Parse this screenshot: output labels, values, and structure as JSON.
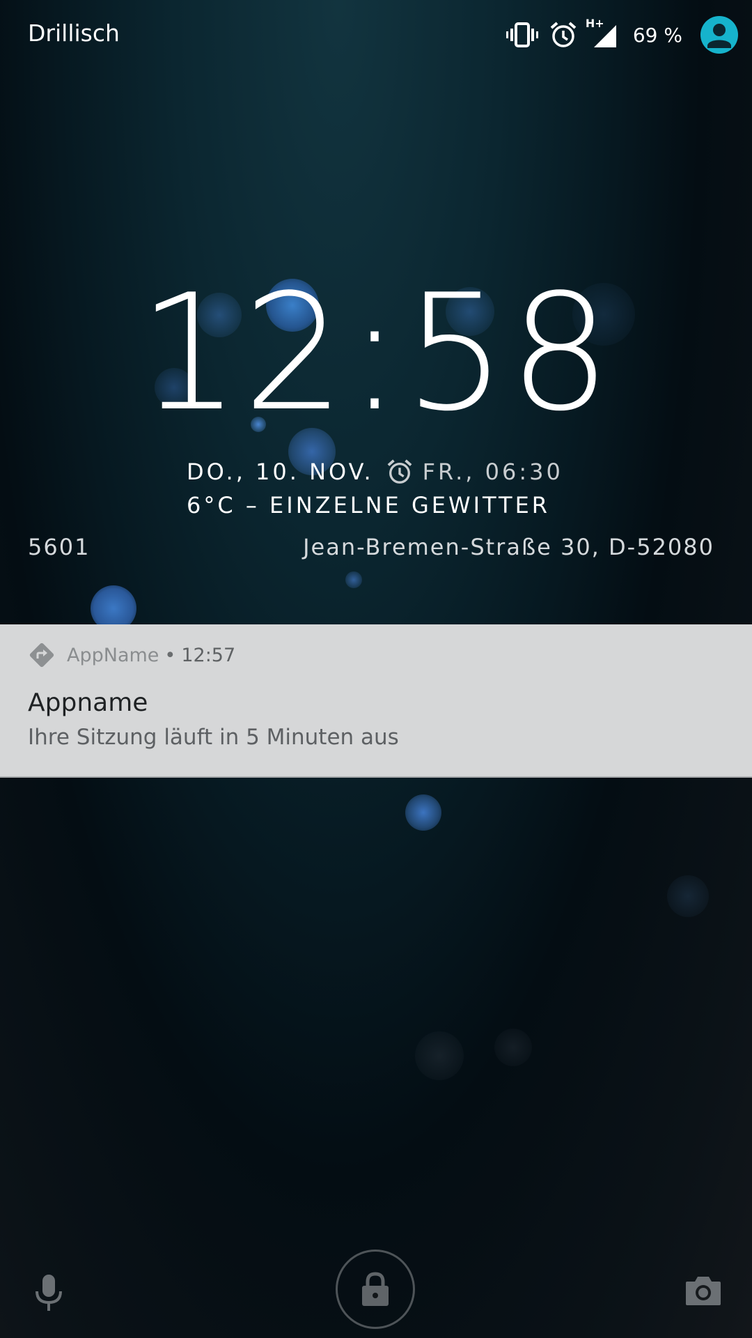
{
  "status_bar": {
    "carrier": "Drillisch",
    "network_type": "H+",
    "battery": "69 %",
    "icons": [
      "vibrate-icon",
      "alarm-icon",
      "signal-icon",
      "user-avatar-icon"
    ]
  },
  "lockscreen": {
    "time": "12:58",
    "date": "DO., 10. NOV.",
    "next_alarm": "FR., 06:30",
    "weather": "6°C – EINZELNE GEWITTER",
    "address_left": "5601",
    "address_right": "Jean-Bremen-Straße 30, D-52080"
  },
  "notification": {
    "app_name": "AppName",
    "separator": "•",
    "time": "12:57",
    "title": "Appname",
    "text": "Ihre Sitzung läuft in 5 Minuten aus",
    "icon": "directions-icon"
  },
  "bottom_bar": {
    "left_icon": "microphone-icon",
    "center_icon": "lock-icon",
    "right_icon": "camera-icon"
  },
  "colors": {
    "accent": "#16b3cc",
    "notification_bg": "#d6d7d8",
    "background_top": "#12343f",
    "background_bottom": "#12161a"
  }
}
